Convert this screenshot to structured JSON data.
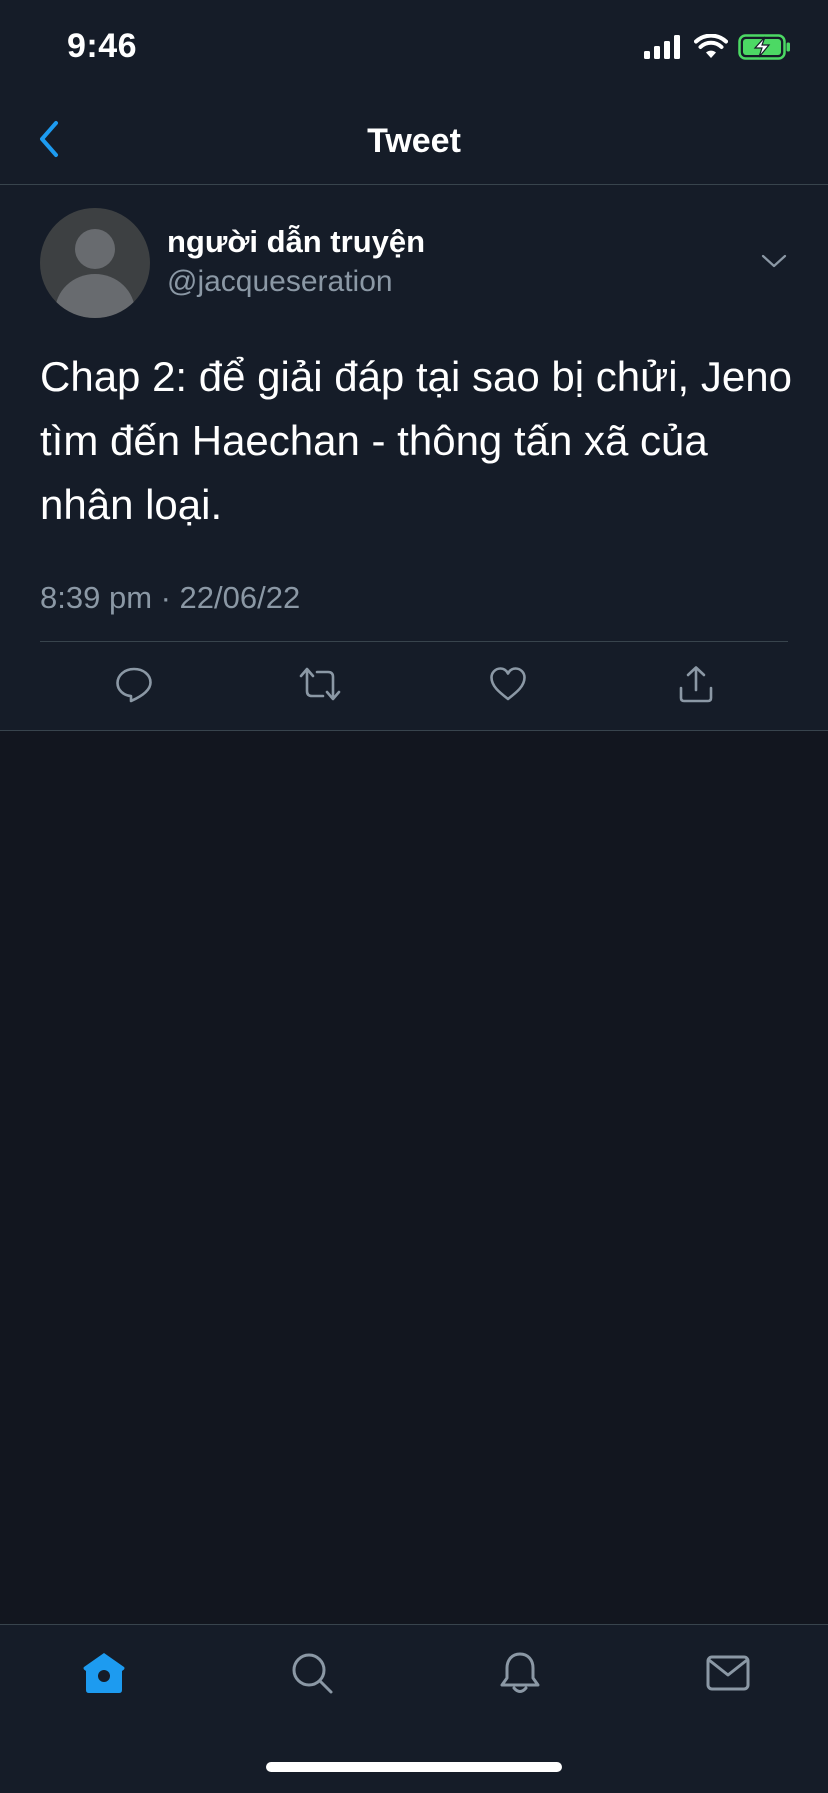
{
  "status_bar": {
    "time": "9:46",
    "icons": [
      "signal-icon",
      "wifi-icon",
      "battery-charging-icon"
    ]
  },
  "nav": {
    "back_icon": "chevron-left-icon",
    "title": "Tweet"
  },
  "tweet": {
    "author": {
      "display_name": "người dẫn truyện",
      "handle": "@jacqueseration",
      "avatar": "default-avatar"
    },
    "text": "Chap 2: để giải đáp tại sao bị chửi, Jeno tìm đến Haechan - thông tấn xã của nhân loại.",
    "timestamp": "8:39 pm · 22/06/22",
    "actions": [
      "reply-icon",
      "retweet-icon",
      "like-icon",
      "share-icon"
    ]
  },
  "tab_bar": {
    "tabs": [
      "home-icon",
      "search-icon",
      "notifications-icon",
      "messages-icon"
    ],
    "active": "home-icon"
  },
  "colors": {
    "accent": "#1d9bf0",
    "background": "#12161f",
    "surface": "#151c28",
    "divider": "#38444d",
    "secondary_text": "#8b98a5",
    "battery_green": "#4cd964"
  }
}
